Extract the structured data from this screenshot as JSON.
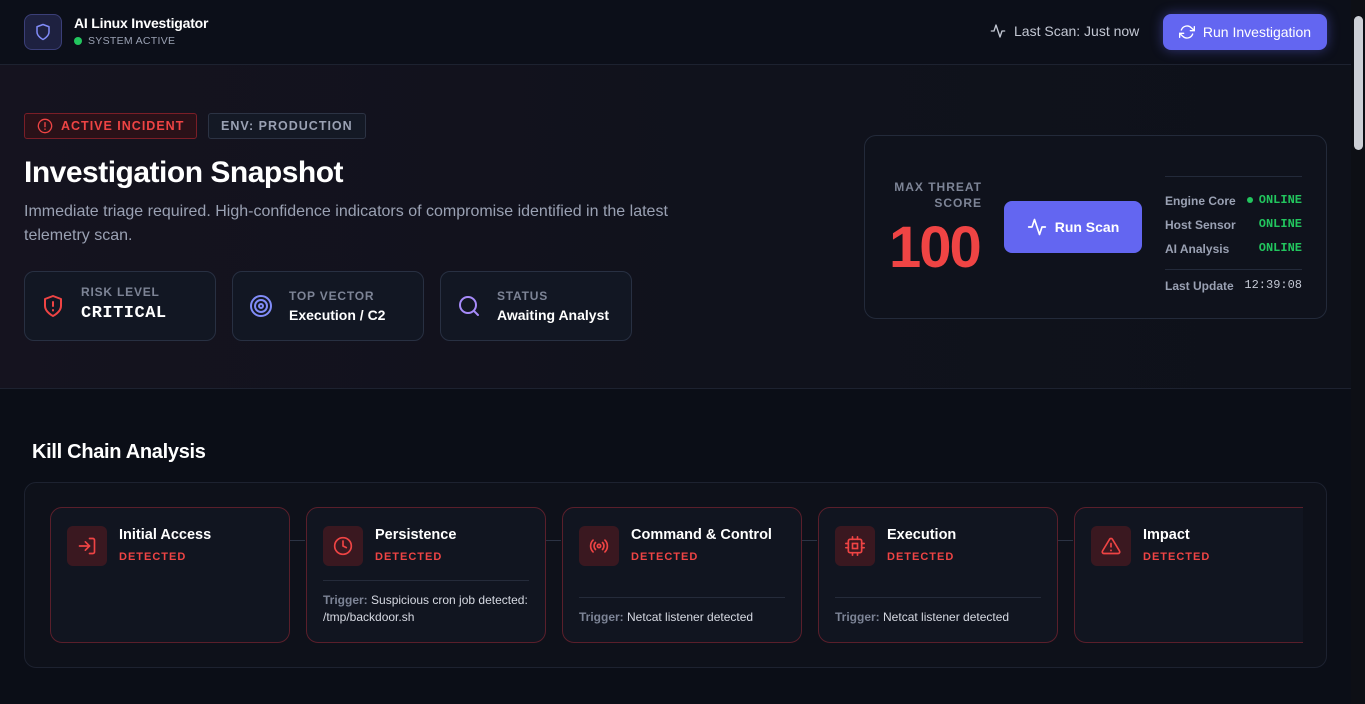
{
  "app": {
    "title": "AI Linux Investigator",
    "status": "SYSTEM ACTIVE"
  },
  "header": {
    "last_scan": "Last Scan: Just now",
    "run_investigation": "Run Investigation"
  },
  "hero": {
    "badge_incident": "ACTIVE INCIDENT",
    "badge_env": "ENV: PRODUCTION",
    "title": "Investigation Snapshot",
    "description": "Immediate triage required. High-confidence indicators of compromise identified in the latest telemetry scan.",
    "metrics": [
      {
        "label": "RISK LEVEL",
        "value": "CRITICAL",
        "icon": "shield-alert-icon"
      },
      {
        "label": "TOP VECTOR",
        "value": "Execution / C2",
        "icon": "target-icon"
      },
      {
        "label": "STATUS",
        "value": "Awaiting Analyst",
        "icon": "search-icon"
      }
    ]
  },
  "threat": {
    "label": "MAX THREAT SCORE",
    "score": "100",
    "run_scan": "Run Scan",
    "systems": [
      {
        "name": "Engine Core",
        "state": "ONLINE"
      },
      {
        "name": "Host Sensor",
        "state": "ONLINE"
      },
      {
        "name": "AI Analysis",
        "state": "ONLINE"
      }
    ],
    "last_update_label": "Last Update",
    "last_update": "12:39:08"
  },
  "kill_chain": {
    "title": "Kill Chain Analysis",
    "stages": [
      {
        "name": "Initial Access",
        "status": "DETECTED",
        "icon": "log-in-icon",
        "trigger_label": "",
        "trigger": ""
      },
      {
        "name": "Persistence",
        "status": "DETECTED",
        "icon": "clock-icon",
        "trigger_label": "Trigger:",
        "trigger": "Suspicious cron job detected: /tmp/backdoor.sh"
      },
      {
        "name": "Command & Control",
        "status": "DETECTED",
        "icon": "radio-icon",
        "trigger_label": "Trigger:",
        "trigger": "Netcat listener detected"
      },
      {
        "name": "Execution",
        "status": "DETECTED",
        "icon": "cpu-icon",
        "trigger_label": "Trigger:",
        "trigger": "Netcat listener detected"
      },
      {
        "name": "Impact",
        "status": "DETECTED",
        "icon": "warning-icon",
        "trigger_label": "",
        "trigger": ""
      }
    ]
  },
  "colors": {
    "accent": "#6366f1",
    "danger": "#ef4444",
    "success": "#22c55e",
    "background": "#0b0e17"
  }
}
